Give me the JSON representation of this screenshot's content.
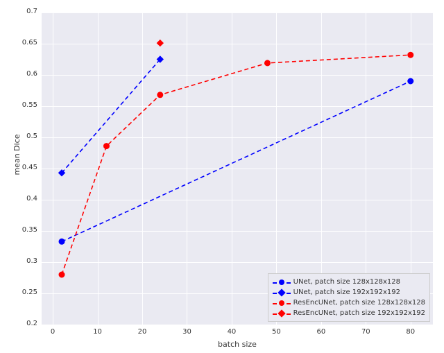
{
  "chart_data": {
    "type": "line",
    "xlabel": "batch size",
    "ylabel": "mean Dice",
    "xlim": [
      -2.5,
      85
    ],
    "ylim": [
      0.2,
      0.7
    ],
    "xticks": [
      0,
      10,
      20,
      30,
      40,
      50,
      60,
      70,
      80
    ],
    "yticks": [
      0.2,
      0.25,
      0.3,
      0.35,
      0.4,
      0.45,
      0.5,
      0.55,
      0.6,
      0.65,
      0.7
    ],
    "xtick_labels": [
      "0",
      "10",
      "20",
      "30",
      "40",
      "50",
      "60",
      "70",
      "80"
    ],
    "ytick_labels": [
      "0.2",
      "0.25",
      "0.3",
      "0.35",
      "0.4",
      "0.45",
      "0.5",
      "0.55",
      "0.6",
      "0.65",
      "0.7"
    ],
    "series": [
      {
        "name": "UNet, patch size 128x128x128",
        "color": "#0000ff",
        "marker": "circle",
        "x": [
          2,
          80
        ],
        "y": [
          0.333,
          0.59
        ]
      },
      {
        "name": "UNet, patch size 192x192x192",
        "color": "#0000ff",
        "marker": "diamond",
        "x": [
          2,
          24
        ],
        "y": [
          0.443,
          0.625
        ]
      },
      {
        "name": "ResEncUNet, patch size 128x128x128",
        "color": "#ff0000",
        "marker": "circle",
        "x": [
          2,
          12,
          24,
          48,
          80
        ],
        "y": [
          0.28,
          0.486,
          0.568,
          0.619,
          0.632
        ]
      },
      {
        "name": "ResEncUNet, patch size 192x192x192",
        "color": "#ff0000",
        "marker": "diamond",
        "x": [
          24
        ],
        "y": [
          0.651
        ]
      }
    ]
  },
  "legend": {
    "entries": [
      "UNet, patch size 128x128x128",
      "UNet, patch size 192x192x192",
      "ResEncUNet, patch size 128x128x128",
      "ResEncUNet, patch size 192x192x192"
    ]
  }
}
